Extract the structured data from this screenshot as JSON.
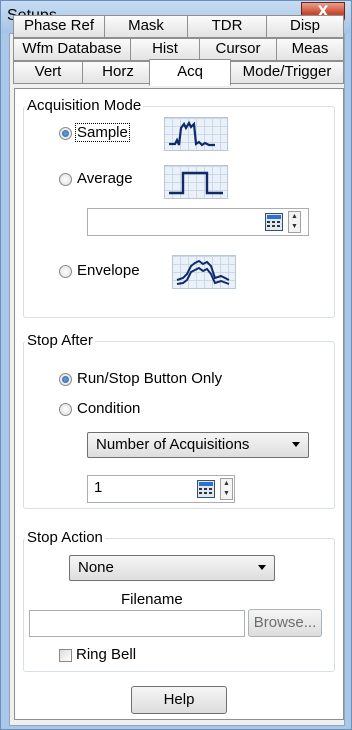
{
  "window": {
    "title": "Setups",
    "close_label": "X"
  },
  "tabs": {
    "row1": [
      {
        "label": "Phase Ref",
        "name": "tab-phase-ref"
      },
      {
        "label": "Mask",
        "name": "tab-mask"
      },
      {
        "label": "TDR",
        "name": "tab-tdr"
      },
      {
        "label": "Disp",
        "name": "tab-disp"
      }
    ],
    "row2": [
      {
        "label": "Wfm Database",
        "name": "tab-wfm-database"
      },
      {
        "label": "Hist",
        "name": "tab-hist"
      },
      {
        "label": "Cursor",
        "name": "tab-cursor"
      },
      {
        "label": "Meas",
        "name": "tab-meas"
      }
    ],
    "row3": [
      {
        "label": "Vert",
        "name": "tab-vert"
      },
      {
        "label": "Horz",
        "name": "tab-horz"
      },
      {
        "label": "Acq",
        "name": "tab-acq"
      },
      {
        "label": "Mode/Trigger",
        "name": "tab-mode-trigger"
      }
    ],
    "active": "Acq"
  },
  "acquisition_mode": {
    "label": "Acquisition Mode",
    "options": {
      "sample": "Sample",
      "average": "Average",
      "envelope": "Envelope"
    },
    "selected": "Sample",
    "average_count": ""
  },
  "stop_after": {
    "label": "Stop After",
    "options": {
      "run_stop": "Run/Stop Button Only",
      "condition": "Condition"
    },
    "selected": "Run/Stop Button Only",
    "condition_value": "Number of Acquisitions",
    "count": "1"
  },
  "stop_action": {
    "label": "Stop Action",
    "action_value": "None",
    "filename_label": "Filename",
    "filename_value": "",
    "browse_label": "Browse...",
    "ring_bell_label": "Ring Bell",
    "ring_bell_checked": false
  },
  "help_label": "Help",
  "colors": {
    "title_bar": "#a9c7e8",
    "close_button": "#c8472d",
    "radio_selected": "#1e5ea8"
  }
}
